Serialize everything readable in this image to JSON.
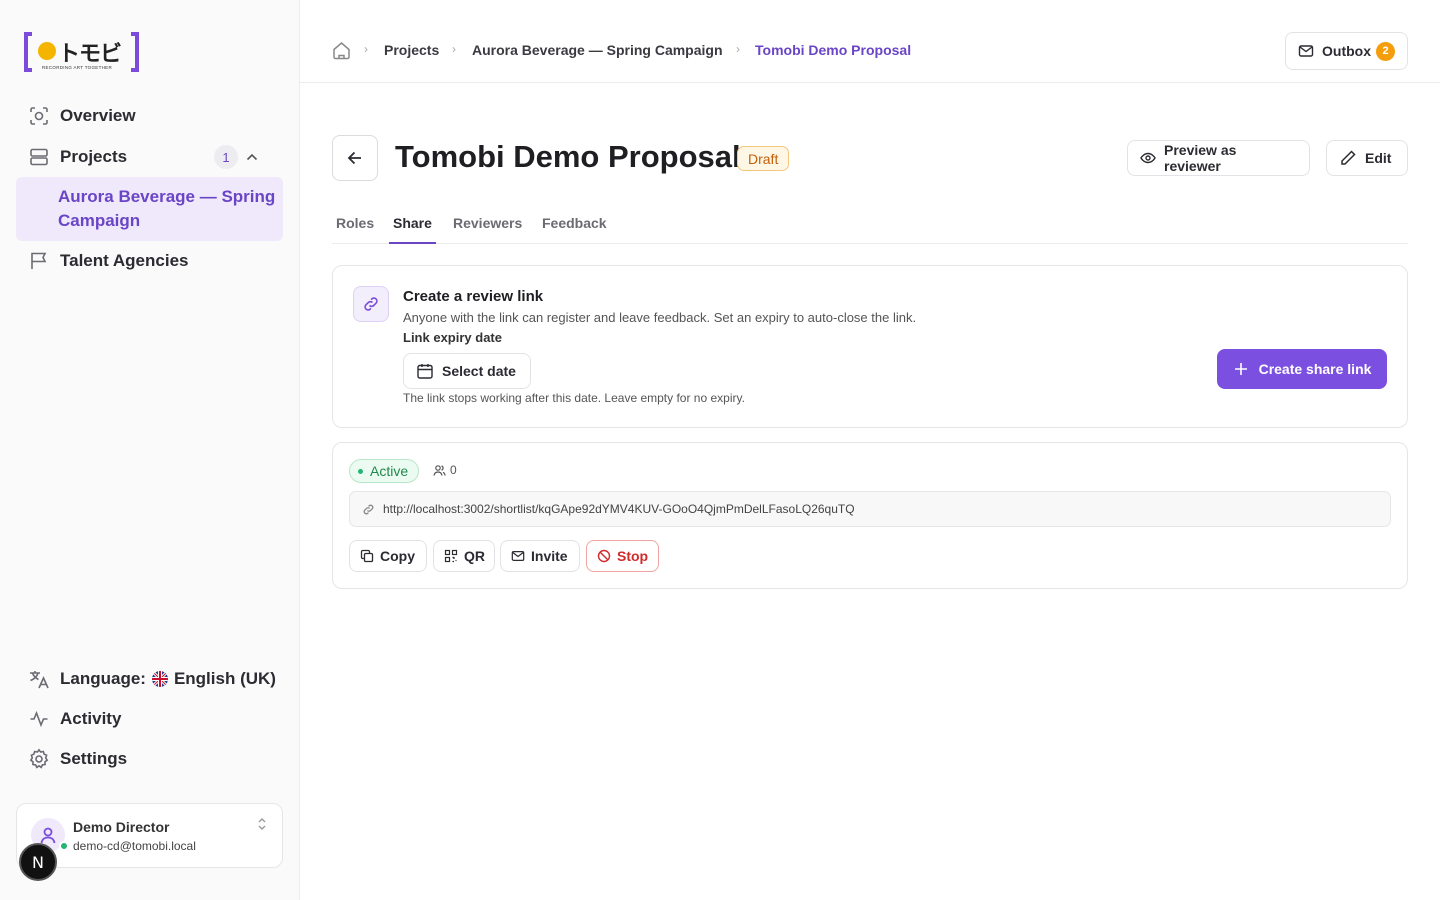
{
  "app": {
    "logo_text": "トモビ",
    "logo_tagline": "RECORDING ART TOGETHER"
  },
  "sidebar": {
    "items": [
      {
        "label": "Overview",
        "icon": "scan-icon"
      },
      {
        "label": "Projects",
        "icon": "stack-icon",
        "count": "1"
      },
      {
        "label": "Talent Agencies",
        "icon": "flag-icon"
      }
    ],
    "active_sub_item": "Aurora Beverage — Spring Campaign",
    "language_label": "Language:",
    "language_value": "English (UK)",
    "activity_label": "Activity",
    "settings_label": "Settings",
    "user": {
      "name": "Demo Director",
      "email": "demo-cd@tomobi.local",
      "status": "online"
    },
    "dev_badge": "N"
  },
  "breadcrumb": {
    "items": [
      "Projects",
      "Aurora Beverage — Spring Campaign",
      "Tomobi Demo Proposal"
    ]
  },
  "outbox": {
    "label": "Outbox",
    "count": "2"
  },
  "header": {
    "title": "Tomobi Demo Proposal",
    "status": "Draft",
    "preview_label": "Preview as reviewer",
    "edit_label": "Edit"
  },
  "tabs": [
    {
      "label": "Roles",
      "active": false
    },
    {
      "label": "Share",
      "active": true
    },
    {
      "label": "Reviewers",
      "active": false
    },
    {
      "label": "Feedback",
      "active": false
    }
  ],
  "create_link": {
    "title": "Create a review link",
    "description": "Anyone with the link can register and leave feedback. Set an expiry to auto-close the link.",
    "expiry_label": "Link expiry date",
    "date_placeholder": "Select date",
    "expiry_help": "The link stops working after this date. Leave empty for no expiry.",
    "create_button": "Create share link"
  },
  "share_link": {
    "status": "Active",
    "reviewer_count": "0",
    "url": "http://localhost:3002/shortlist/kqGApe92dYMV4KUV-GOoO4QjmPmDelLFasoLQ26quTQ",
    "actions": {
      "copy": "Copy",
      "qr": "QR",
      "invite": "Invite",
      "stop": "Stop"
    }
  },
  "colors": {
    "accent": "#7b4fe0",
    "accent_text": "#6a45c6",
    "draft": "#c2600a",
    "active": "#1f8a4c",
    "danger": "#d02b2b",
    "outbox_badge": "#f59e0b"
  }
}
